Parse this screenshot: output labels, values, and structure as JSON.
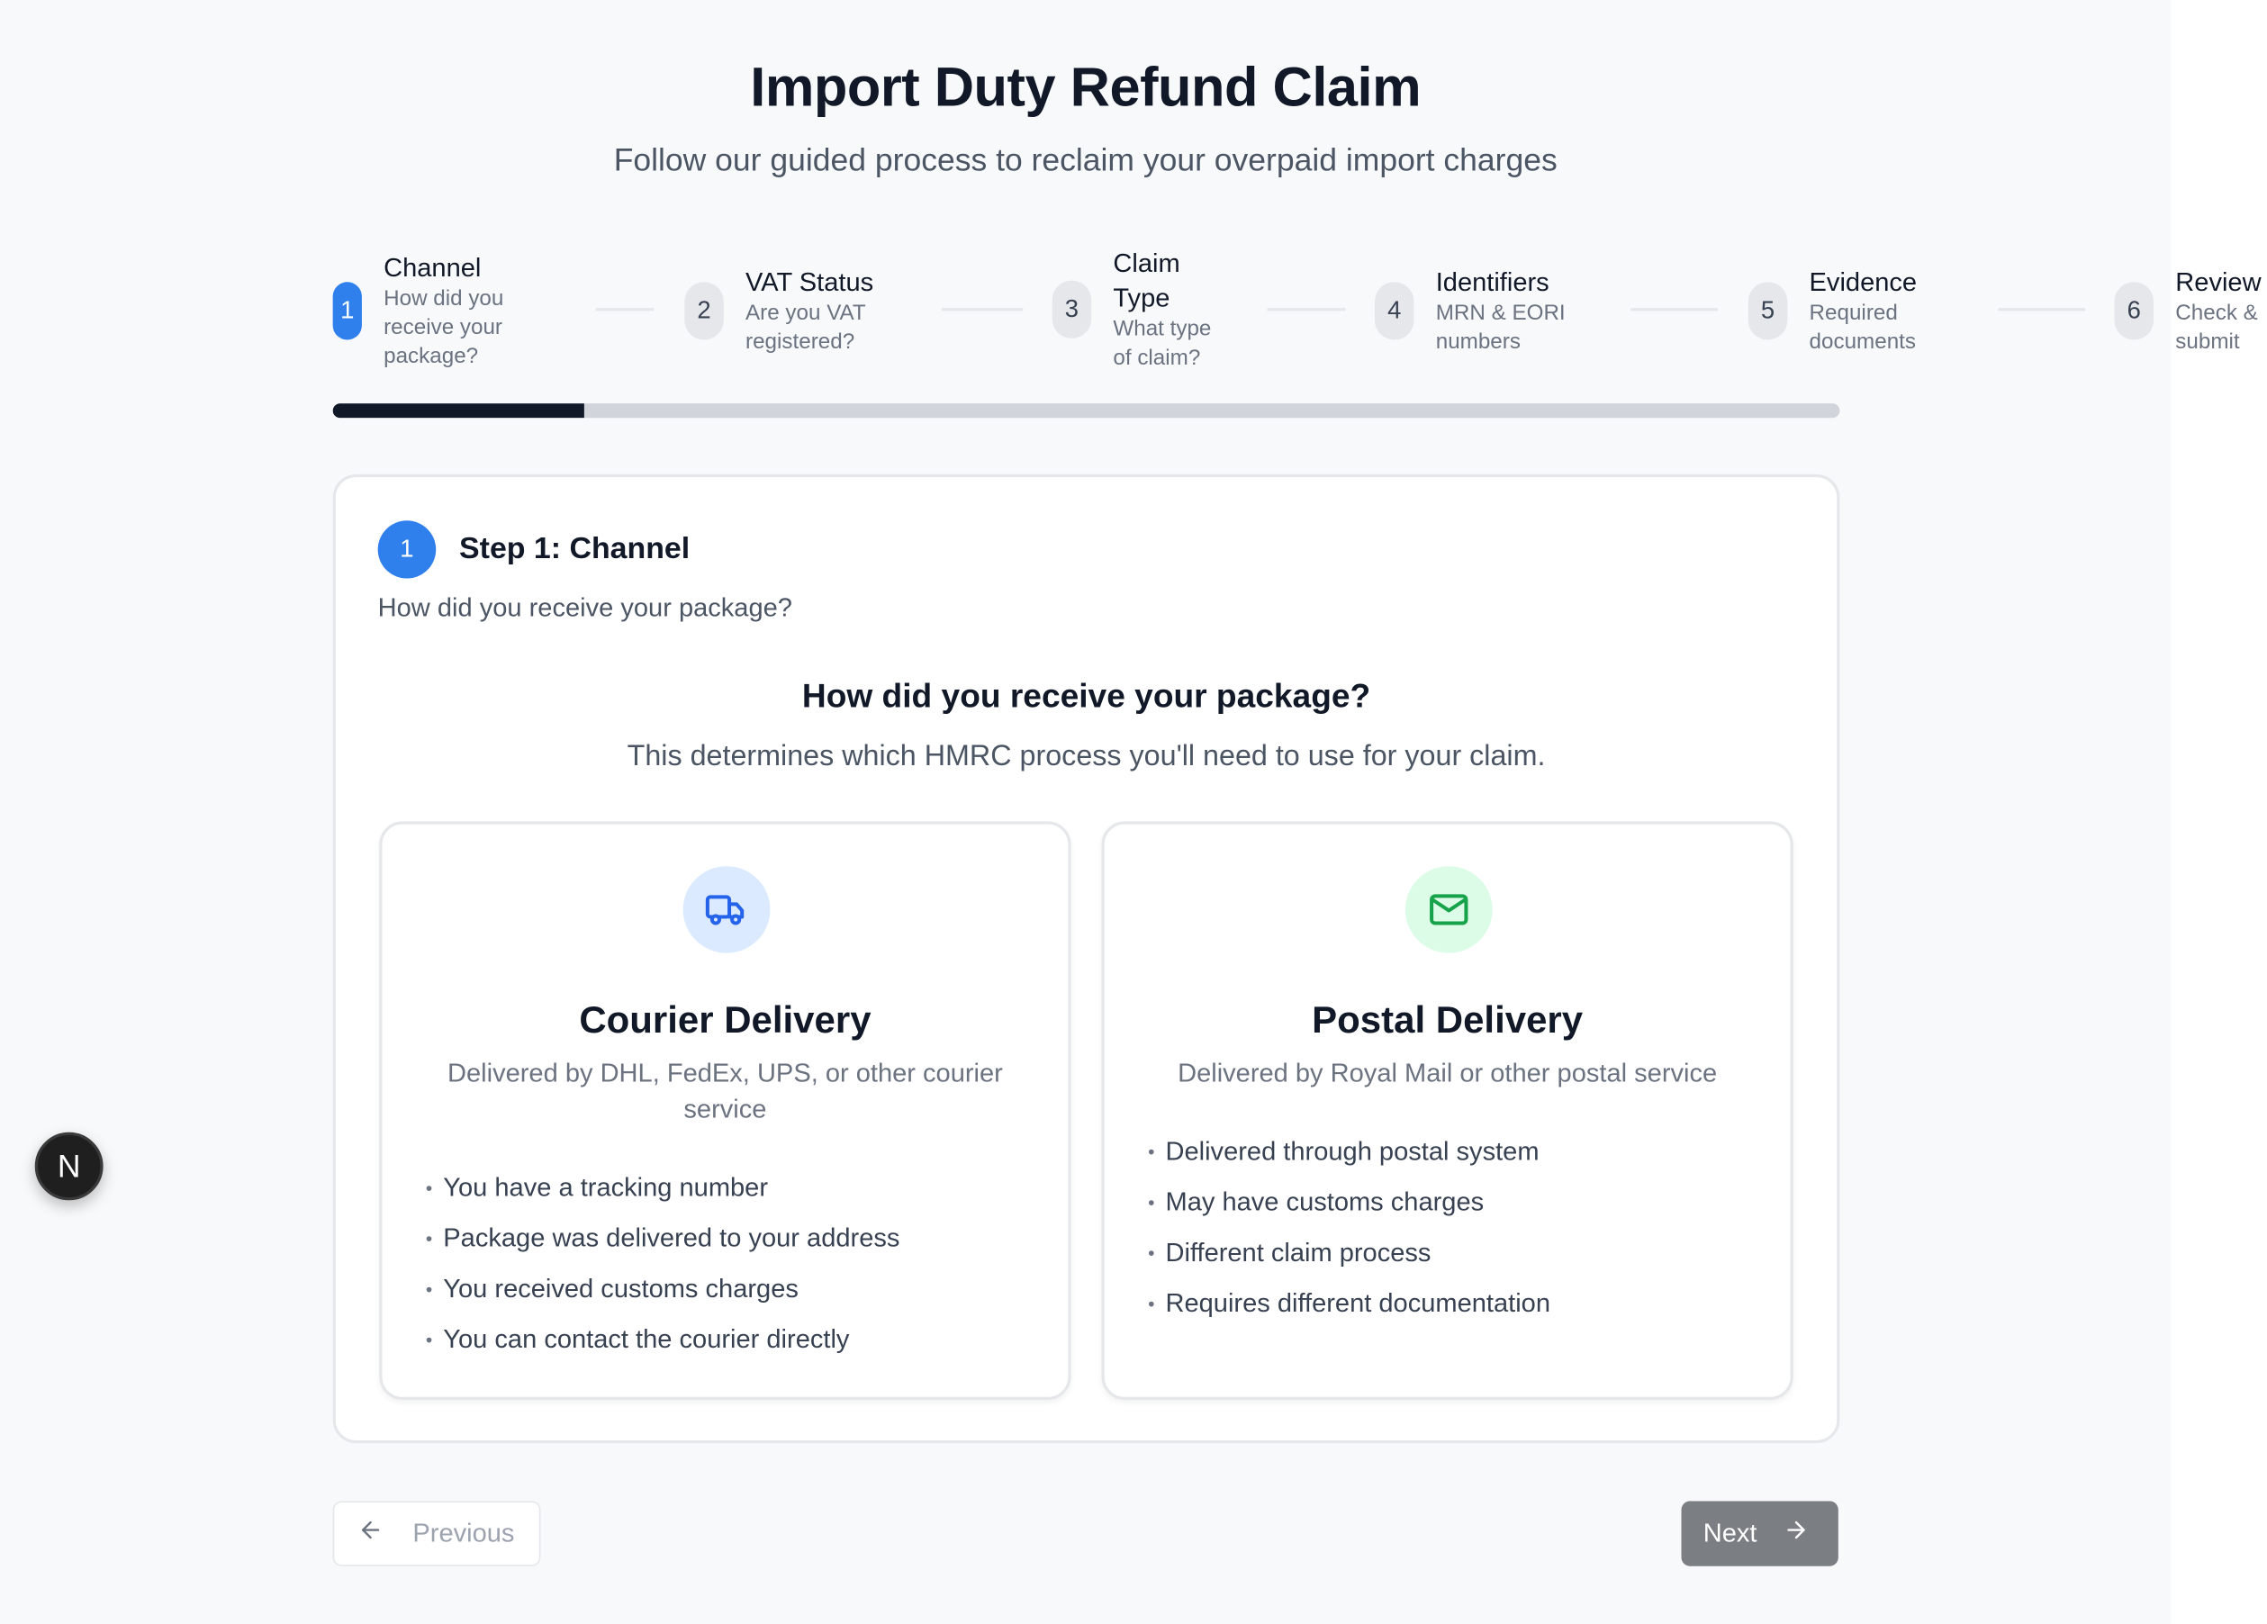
{
  "header": {
    "title": "Import Duty Refund Claim",
    "subtitle": "Follow our guided process to reclaim your overpaid import charges"
  },
  "steps": [
    {
      "number": "1",
      "title": "Channel",
      "desc": "How did you receive your package?",
      "active": true
    },
    {
      "number": "2",
      "title": "VAT Status",
      "desc": "Are you VAT registered?",
      "active": false
    },
    {
      "number": "3",
      "title": "Claim Type",
      "desc": "What type of claim?",
      "active": false
    },
    {
      "number": "4",
      "title": "Identifiers",
      "desc": "MRN & EORI numbers",
      "active": false
    },
    {
      "number": "5",
      "title": "Evidence",
      "desc": "Required documents",
      "active": false
    },
    {
      "number": "6",
      "title": "Review",
      "desc": "Check & submit",
      "active": false
    }
  ],
  "progress": {
    "fraction": 0.1667
  },
  "card": {
    "badge": "1",
    "title": "Step 1: Channel",
    "subtitle": "How did you receive your package?",
    "question": "How did you receive your package?",
    "question_desc": "This determines which HMRC process you'll need to use for your claim."
  },
  "options": [
    {
      "icon": "truck-icon",
      "title": "Courier Delivery",
      "desc": "Delivered by DHL, FedEx, UPS, or other courier service",
      "bullets": [
        "You have a tracking number",
        "Package was delivered to your address",
        "You received customs charges",
        "You can contact the courier directly"
      ]
    },
    {
      "icon": "envelope-icon",
      "title": "Postal Delivery",
      "desc": "Delivered by Royal Mail or other postal service",
      "bullets": [
        "Delivered through postal system",
        "May have customs charges",
        "Different claim process",
        "Requires different documentation"
      ]
    }
  ],
  "nav": {
    "previous": "Previous",
    "next": "Next"
  },
  "dev_badge": {
    "letter": "N"
  },
  "colors": {
    "accent": "#2f80ed",
    "courier_icon_bg": "#dbeafe",
    "courier_icon": "#2563eb",
    "postal_icon_bg": "#dcfce7",
    "postal_icon": "#16a34a",
    "next_button": "#7b7f84"
  }
}
